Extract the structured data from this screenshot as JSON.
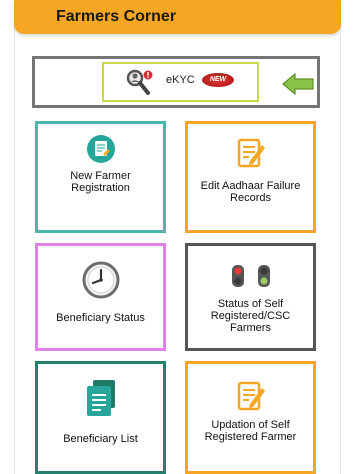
{
  "header": {
    "title": "Farmers Corner"
  },
  "ekyc": {
    "label": "eKYC",
    "badge": "NEW"
  },
  "cards": [
    {
      "label": "New Farmer Registration",
      "icon": "farmer-registration-icon",
      "border": "#4db6ac"
    },
    {
      "label": "Edit Aadhaar Failure Records",
      "icon": "edit-document-icon",
      "border": "#f5a623"
    },
    {
      "label": "Beneficiary Status",
      "icon": "clock-icon",
      "border": "#e082e8"
    },
    {
      "label": "Status of Self Registered/CSC Farmers",
      "icon": "traffic-light-icon",
      "border": "#555555"
    },
    {
      "label": "Beneficiary List",
      "icon": "document-list-icon",
      "border": "#26806f"
    },
    {
      "label": "Updation of Self Registered Farmer",
      "icon": "edit-document-icon",
      "border": "#f5a623"
    }
  ],
  "colors": {
    "header": "#f5a623",
    "arrow": "#8bc34a",
    "new_badge": "#e53935"
  }
}
